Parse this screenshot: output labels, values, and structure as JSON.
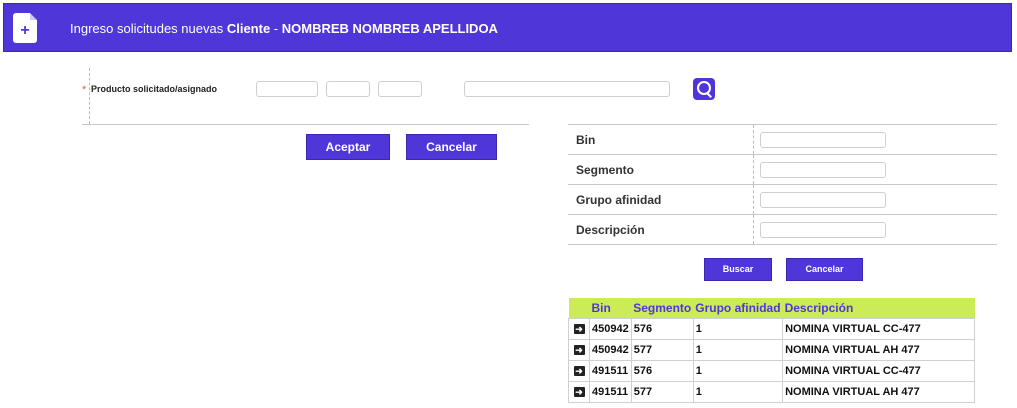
{
  "header": {
    "prefix": "Ingreso solicitudes nuevas",
    "client_label": "Cliente",
    "separator": "-",
    "client_name": "NOMBREB NOMBREB APELLIDOA"
  },
  "product": {
    "required_mark": "*",
    "label": "Producto solicitado/asignado"
  },
  "actions": {
    "accept": "Aceptar",
    "cancel": "Cancelar"
  },
  "filter": {
    "bin_label": "Bin",
    "segment_label": "Segmento",
    "affinity_label": "Grupo afinidad",
    "description_label": "Descripción",
    "search": "Buscar",
    "cancel": "Cancelar"
  },
  "results": {
    "columns": [
      "Bin",
      "Segmento",
      "Grupo afinidad",
      "Descripción"
    ],
    "rows": [
      {
        "bin": "450942",
        "segment": "576",
        "group": "1",
        "description": "NOMINA VIRTUAL CC-477"
      },
      {
        "bin": "450942",
        "segment": "577",
        "group": "1",
        "description": "NOMINA VIRTUAL AH 477"
      },
      {
        "bin": "491511",
        "segment": "576",
        "group": "1",
        "description": "NOMINA VIRTUAL CC-477"
      },
      {
        "bin": "491511",
        "segment": "577",
        "group": "1",
        "description": "NOMINA VIRTUAL AH 477"
      }
    ]
  },
  "colors": {
    "primary": "#4f36d9",
    "grid_header": "#ccec57",
    "required": "#e0642c"
  },
  "icons": {
    "header": "document-add-icon",
    "search": "search-icon",
    "row": "arrow-right-icon"
  }
}
